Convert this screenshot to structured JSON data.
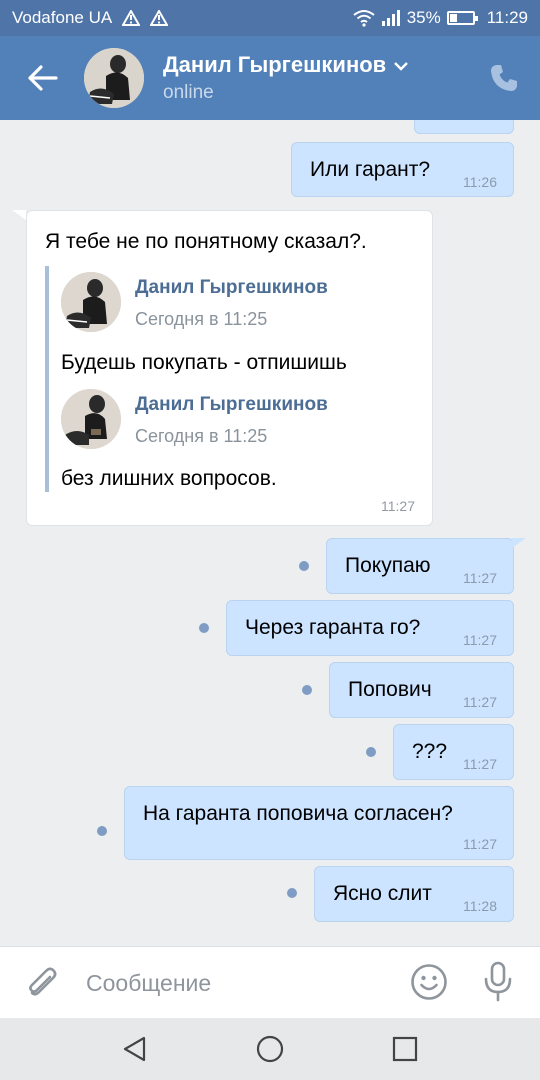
{
  "status_bar": {
    "carrier": "Vodafone UA",
    "battery": "35%",
    "battery_level": 0.35,
    "time": "11:29"
  },
  "header": {
    "contact_name": "Данил Гыргешкинов",
    "presence": "online"
  },
  "messages": [
    {
      "direction": "out",
      "text": "Или гарант?",
      "time": "11:26"
    },
    {
      "direction": "in",
      "text": "Я тебе не по понятному сказал?.",
      "time": "11:27",
      "forwarded": [
        {
          "author": "Данил Гыргешкинов",
          "date": "Сегодня в 11:25",
          "text": "Будешь покупать - отпишишь"
        },
        {
          "author": "Данил Гыргешкинов",
          "date": "Сегодня в 11:25",
          "text": "без лишних вопросов."
        }
      ]
    },
    {
      "direction": "out",
      "text": "Покупаю",
      "time": "11:27",
      "unread": true
    },
    {
      "direction": "out",
      "text": "Через гаранта го?",
      "time": "11:27",
      "unread": true
    },
    {
      "direction": "out",
      "text": "Попович",
      "time": "11:27",
      "unread": true
    },
    {
      "direction": "out",
      "text": "???",
      "time": "11:27",
      "unread": true
    },
    {
      "direction": "out",
      "text": "На гаранта поповича согласен?",
      "time": "11:27",
      "unread": true
    },
    {
      "direction": "out",
      "text": "Ясно слит",
      "time": "11:28",
      "unread": true
    }
  ],
  "input": {
    "placeholder": "Сообщение",
    "value": ""
  },
  "icons": {
    "back": "arrow-left-icon",
    "dropdown": "chevron-down-icon",
    "call": "phone-icon",
    "attach": "paperclip-icon",
    "emoji": "smile-icon",
    "voice": "microphone-icon",
    "nav_back": "triangle-back-icon",
    "nav_home": "circle-home-icon",
    "nav_recent": "square-recent-icon"
  },
  "colors": {
    "header": "#5181b8",
    "status_bar": "#4e74a8",
    "outgoing_bubble": "#cce4ff",
    "incoming_bubble": "#ffffff",
    "chat_background": "#edeef0",
    "link": "#4c6d94"
  }
}
